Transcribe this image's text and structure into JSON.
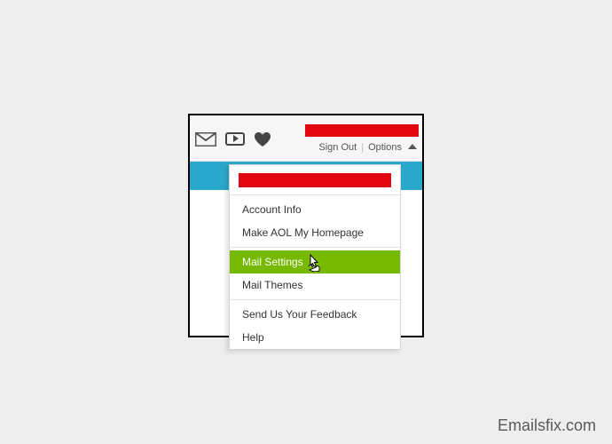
{
  "toolbar": {
    "sign_out_label": "Sign Out",
    "options_label": "Options"
  },
  "dropdown": {
    "items": [
      {
        "label": "Account Info"
      },
      {
        "label": "Make AOL My Homepage"
      }
    ],
    "items2": [
      {
        "label": "Mail Settings"
      },
      {
        "label": "Mail Themes"
      }
    ],
    "items3": [
      {
        "label": "Send Us Your Feedback"
      },
      {
        "label": "Help"
      }
    ]
  },
  "footer": {
    "attribution": "Emailsfix.com"
  }
}
